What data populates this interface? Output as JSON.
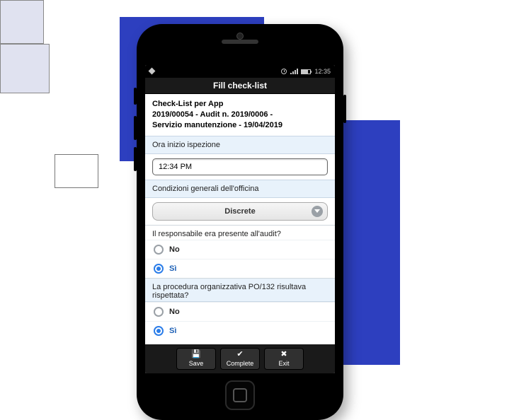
{
  "statusbar": {
    "time": "12:35"
  },
  "titlebar": {
    "title": "Fill check-list"
  },
  "header": {
    "line1": "Check-List per App",
    "line2": "2019/00054 - Audit n. 2019/0006 -",
    "line3": "Servizio manutenzione - 19/04/2019"
  },
  "fields": {
    "inspection_start": {
      "label": "Ora inizio ispezione",
      "value": "12:34 PM"
    },
    "workshop_conditions": {
      "label": "Condizioni generali dell'officina",
      "selected": "Discrete"
    },
    "responsible_present": {
      "question": "Il responsabile era presente all'audit?",
      "no": "No",
      "yes": "Sì"
    },
    "procedure_respected": {
      "question": "La procedura organizzativa PO/132 risultava rispettata?",
      "no": "No",
      "yes": "Sì"
    }
  },
  "bottombar": {
    "save": "Save",
    "complete": "Complete",
    "exit": "Exit"
  }
}
